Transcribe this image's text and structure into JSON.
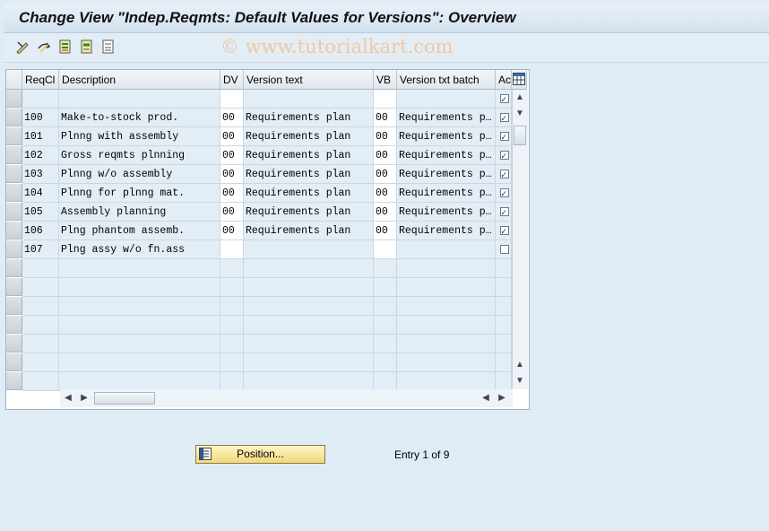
{
  "title": "Change View \"Indep.Reqmts: Default Values for Versions\": Overview",
  "watermark": "© www.tutorialkart.com",
  "toolbar": {
    "icons": [
      "display-change-icon",
      "other-entry-icon",
      "select-all-icon",
      "select-block-icon",
      "deselect-all-icon"
    ]
  },
  "table": {
    "columns": [
      "ReqCl",
      "Description",
      "DV",
      "Version text",
      "VB",
      "Version txt batch",
      "Ac"
    ],
    "rows": [
      {
        "reqcl": "",
        "desc": "",
        "dv": "",
        "vtext": "",
        "vb": "",
        "vbatch": "",
        "active": true
      },
      {
        "reqcl": "100",
        "desc": "Make-to-stock prod.",
        "dv": "00",
        "vtext": "Requirements plan",
        "vb": "00",
        "vbatch": "Requirements p…",
        "active": true
      },
      {
        "reqcl": "101",
        "desc": "Plnng with assembly",
        "dv": "00",
        "vtext": "Requirements plan",
        "vb": "00",
        "vbatch": "Requirements p…",
        "active": true
      },
      {
        "reqcl": "102",
        "desc": "Gross reqmts plnning",
        "dv": "00",
        "vtext": "Requirements plan",
        "vb": "00",
        "vbatch": "Requirements p…",
        "active": true
      },
      {
        "reqcl": "103",
        "desc": "Plnng w/o assembly",
        "dv": "00",
        "vtext": "Requirements plan",
        "vb": "00",
        "vbatch": "Requirements p…",
        "active": true
      },
      {
        "reqcl": "104",
        "desc": "Plnng for plnng mat.",
        "dv": "00",
        "vtext": "Requirements plan",
        "vb": "00",
        "vbatch": "Requirements p…",
        "active": true
      },
      {
        "reqcl": "105",
        "desc": "Assembly planning",
        "dv": "00",
        "vtext": "Requirements plan",
        "vb": "00",
        "vbatch": "Requirements p…",
        "active": true
      },
      {
        "reqcl": "106",
        "desc": "Plng phantom assemb.",
        "dv": "00",
        "vtext": "Requirements plan",
        "vb": "00",
        "vbatch": "Requirements p…",
        "active": true
      },
      {
        "reqcl": "107",
        "desc": "Plng assy w/o fn.ass",
        "dv": "",
        "vtext": "",
        "vb": "",
        "vbatch": "",
        "active": false
      }
    ],
    "empty_rows": 7
  },
  "footer": {
    "position_label": "Position...",
    "entry_text": "Entry 1 of 9"
  }
}
